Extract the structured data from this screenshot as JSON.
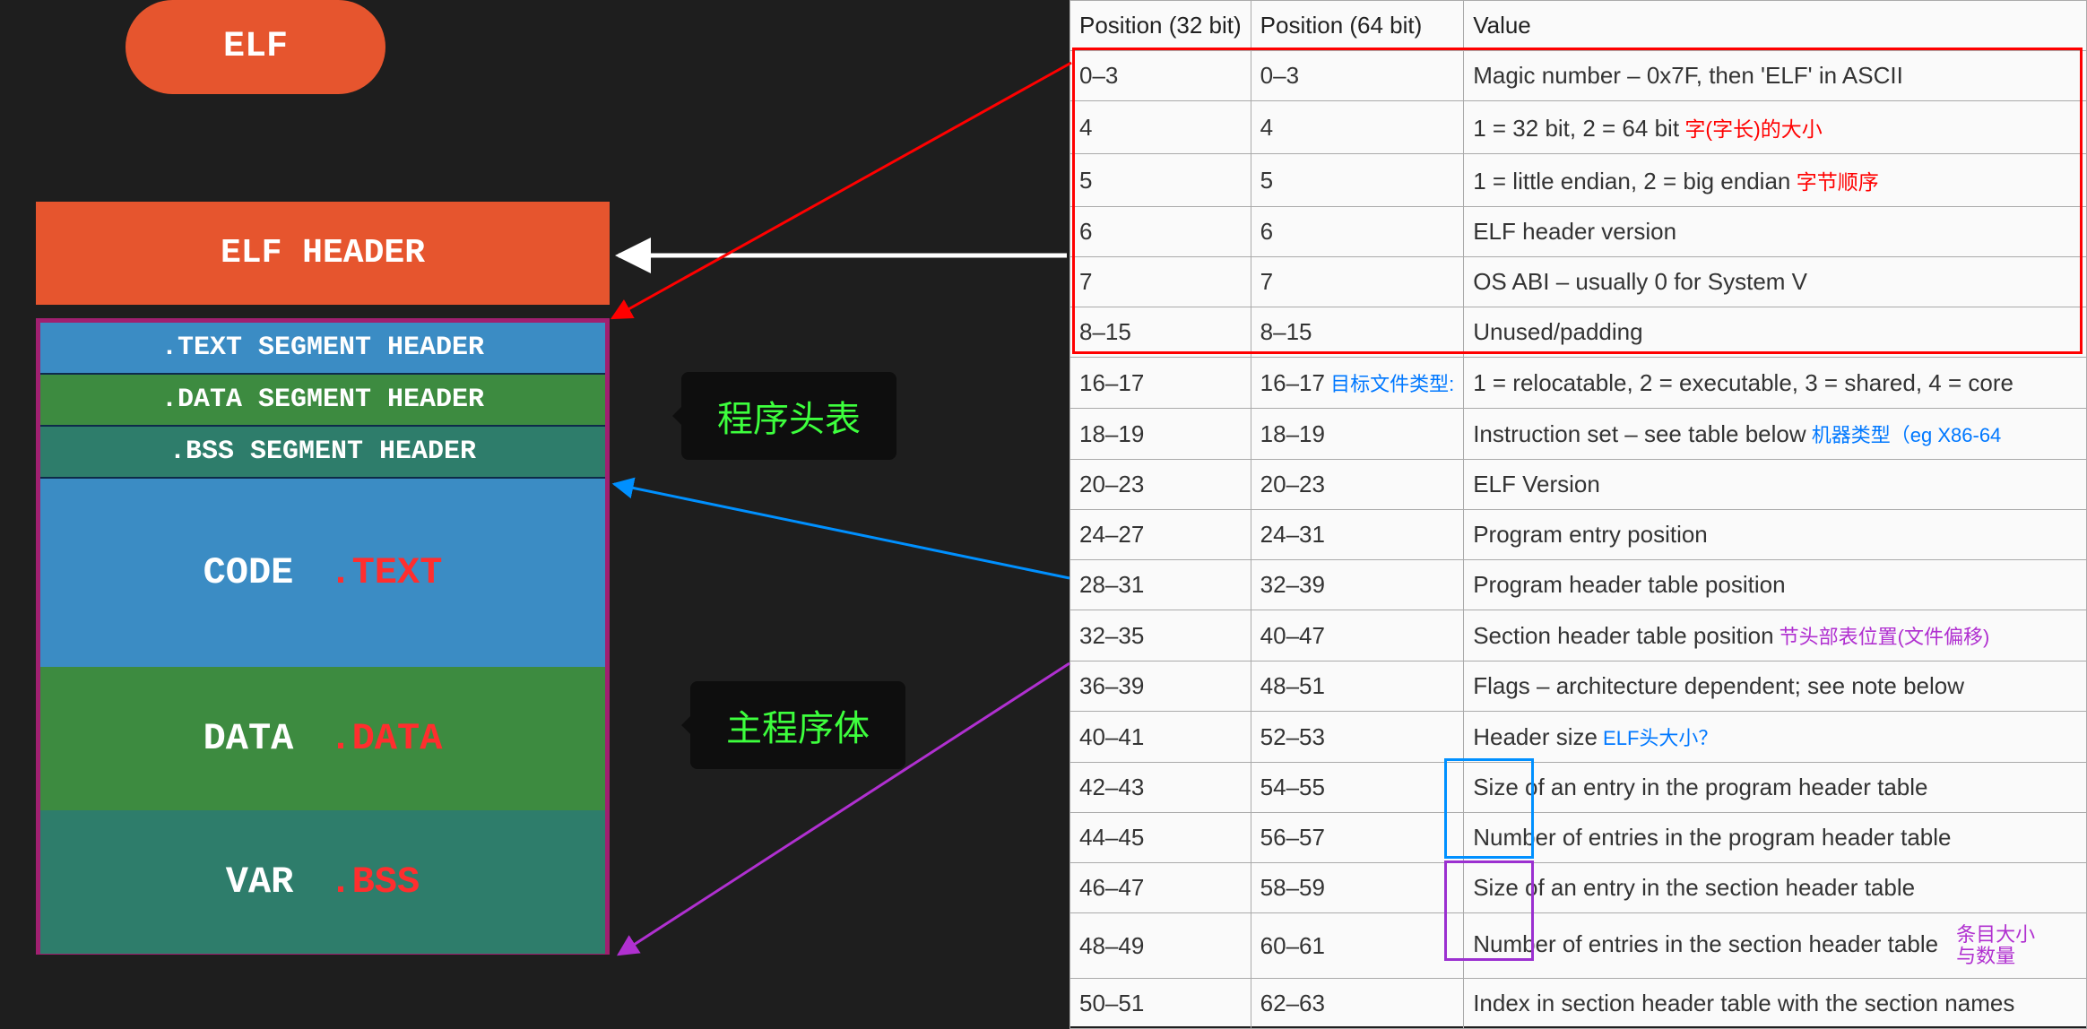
{
  "pill": "ELF",
  "header_box": "ELF HEADER",
  "seg_rows": [
    ".TEXT SEGMENT HEADER",
    ".DATA SEGMENT HEADER",
    ".BSS SEGMENT HEADER"
  ],
  "body": {
    "code": {
      "label": "CODE",
      "section": ".TEXT"
    },
    "data": {
      "label": "DATA",
      "section": ".DATA"
    },
    "bss": {
      "label": "VAR",
      "section": ".BSS"
    }
  },
  "callouts": {
    "program_header_table": "程序头表",
    "main_program_body": "主程序体"
  },
  "table": {
    "headers": [
      "Position (32 bit)",
      "Position (64 bit)",
      "Value"
    ],
    "rows": [
      {
        "a": "0–3",
        "b": "0–3",
        "v": "Magic number – 0x7F, then 'ELF' in ASCII"
      },
      {
        "a": "4",
        "b": "4",
        "v": "1 = 32 bit, 2 = 64 bit",
        "ann": "字(字长)的大小",
        "ann_cls": "ann-red"
      },
      {
        "a": "5",
        "b": "5",
        "v": "1 = little endian, 2 = big endian",
        "ann": "字节顺序",
        "ann_cls": "ann-red"
      },
      {
        "a": "6",
        "b": "6",
        "v": "ELF header version"
      },
      {
        "a": "7",
        "b": "7",
        "v": "OS ABI – usually 0 for System V"
      },
      {
        "a": "8–15",
        "b": "8–15",
        "v": "Unused/padding"
      },
      {
        "a": "16–17",
        "b": "16–17",
        "b_ann": "目标文件类型:",
        "b_ann_cls": "ann-blue",
        "v": "1 = relocatable, 2 = executable, 3 = shared, 4 = core"
      },
      {
        "a": "18–19",
        "b": "18–19",
        "v": "Instruction set – see table below",
        "ann": "机器类型（eg X86-64",
        "ann_cls": "ann-blue"
      },
      {
        "a": "20–23",
        "b": "20–23",
        "v": "ELF Version"
      },
      {
        "a": "24–27",
        "b": "24–31",
        "v": "Program entry position"
      },
      {
        "a": "28–31",
        "b": "32–39",
        "v": "Program header table position"
      },
      {
        "a": "32–35",
        "b": "40–47",
        "v": "Section header table position",
        "ann": "节头部表位置(文件偏移)",
        "ann_cls": "ann-purple"
      },
      {
        "a": "36–39",
        "b": "48–51",
        "v": "Flags – architecture dependent; see note below"
      },
      {
        "a": "40–41",
        "b": "52–53",
        "v": "Header size",
        "ann": "ELF头大小？",
        "ann_cls": "ann-blue"
      },
      {
        "a": "42–43",
        "b": "54–55",
        "v": "Size of an entry in the program header table"
      },
      {
        "a": "44–45",
        "b": "56–57",
        "v": "Number of entries in the program header table"
      },
      {
        "a": "46–47",
        "b": "58–59",
        "v": "Size of an entry in the section header table"
      },
      {
        "a": "48–49",
        "b": "60–61",
        "v": "Number of entries in the section header table",
        "ann": "条目大小\n与数量",
        "ann_cls": "ann-purple",
        "ann_stack": true
      },
      {
        "a": "50–51",
        "b": "62–63",
        "v": "Index in section header table with the section names"
      }
    ]
  }
}
